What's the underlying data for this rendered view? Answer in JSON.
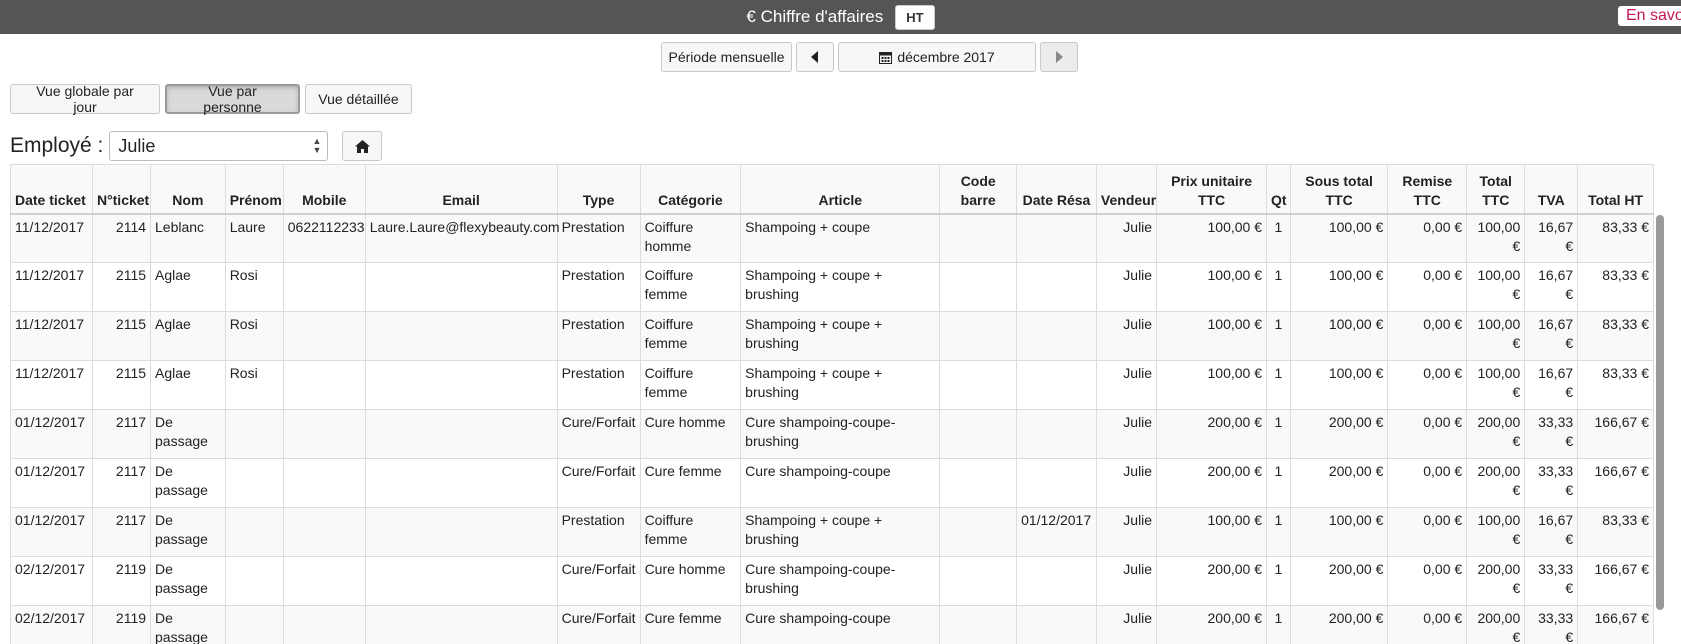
{
  "header": {
    "title": "€ Chiffre d'affaires",
    "badge": "HT",
    "help_link": "En savoir plus"
  },
  "period": {
    "mode_label": "Période mensuelle",
    "current": "décembre 2017",
    "prev_icon": "caret-left-icon",
    "next_icon": "caret-right-icon",
    "calendar_icon": "calendar-icon"
  },
  "views": {
    "global": "Vue globale par jour",
    "person": "Vue par personne",
    "detailed": "Vue détaillée",
    "active": "person"
  },
  "employee": {
    "label": "Employé :",
    "selected": "Julie",
    "home_icon": "home-icon"
  },
  "table": {
    "columns": [
      "Date ticket",
      "N°ticket",
      "Nom",
      "Prénom",
      "Mobile",
      "Email",
      "Type",
      "Catégorie",
      "Article",
      "Code barre",
      "Date Résa",
      "Vendeur",
      "Prix unitaire TTC",
      "Qt",
      "Sous total TTC",
      "Remise TTC",
      "Total TTC",
      "TVA",
      "Total HT"
    ],
    "rows": [
      [
        "11/12/2017",
        "2114",
        "Leblanc",
        "Laure",
        "0622112233",
        "Laure.Laure@flexybeauty.com",
        "Prestation",
        "Coiffure homme",
        "Shampoing + coupe",
        "",
        "",
        "Julie",
        "100,00 €",
        "1",
        "100,00 €",
        "0,00 €",
        "100,00 €",
        "16,67 €",
        "83,33 €"
      ],
      [
        "11/12/2017",
        "2115",
        "Aglae",
        "Rosi",
        "",
        "",
        "Prestation",
        "Coiffure femme",
        "Shampoing + coupe + brushing",
        "",
        "",
        "Julie",
        "100,00 €",
        "1",
        "100,00 €",
        "0,00 €",
        "100,00 €",
        "16,67 €",
        "83,33 €"
      ],
      [
        "11/12/2017",
        "2115",
        "Aglae",
        "Rosi",
        "",
        "",
        "Prestation",
        "Coiffure femme",
        "Shampoing + coupe + brushing",
        "",
        "",
        "Julie",
        "100,00 €",
        "1",
        "100,00 €",
        "0,00 €",
        "100,00 €",
        "16,67 €",
        "83,33 €"
      ],
      [
        "11/12/2017",
        "2115",
        "Aglae",
        "Rosi",
        "",
        "",
        "Prestation",
        "Coiffure femme",
        "Shampoing + coupe + brushing",
        "",
        "",
        "Julie",
        "100,00 €",
        "1",
        "100,00 €",
        "0,00 €",
        "100,00 €",
        "16,67 €",
        "83,33 €"
      ],
      [
        "01/12/2017",
        "2117",
        "De passage",
        "",
        "",
        "",
        "Cure/Forfait",
        "Cure homme",
        "Cure shampoing-coupe-brushing",
        "",
        "",
        "Julie",
        "200,00 €",
        "1",
        "200,00 €",
        "0,00 €",
        "200,00 €",
        "33,33 €",
        "166,67 €"
      ],
      [
        "01/12/2017",
        "2117",
        "De passage",
        "",
        "",
        "",
        "Cure/Forfait",
        "Cure femme",
        "Cure shampoing-coupe",
        "",
        "",
        "Julie",
        "200,00 €",
        "1",
        "200,00 €",
        "0,00 €",
        "200,00 €",
        "33,33 €",
        "166,67 €"
      ],
      [
        "01/12/2017",
        "2117",
        "De passage",
        "",
        "",
        "",
        "Prestation",
        "Coiffure femme",
        "Shampoing + coupe + brushing",
        "",
        "01/12/2017",
        "Julie",
        "100,00 €",
        "1",
        "100,00 €",
        "0,00 €",
        "100,00 €",
        "16,67 €",
        "83,33 €"
      ],
      [
        "02/12/2017",
        "2119",
        "De passage",
        "",
        "",
        "",
        "Cure/Forfait",
        "Cure homme",
        "Cure shampoing-coupe-brushing",
        "",
        "",
        "Julie",
        "200,00 €",
        "1",
        "200,00 €",
        "0,00 €",
        "200,00 €",
        "33,33 €",
        "166,67 €"
      ],
      [
        "02/12/2017",
        "2119",
        "De passage",
        "",
        "",
        "",
        "Cure/Forfait",
        "Cure femme",
        "Cure shampoing-coupe",
        "",
        "",
        "Julie",
        "200,00 €",
        "1",
        "200,00 €",
        "0,00 €",
        "200,00 €",
        "33,33 €",
        "166,67 €"
      ]
    ]
  }
}
